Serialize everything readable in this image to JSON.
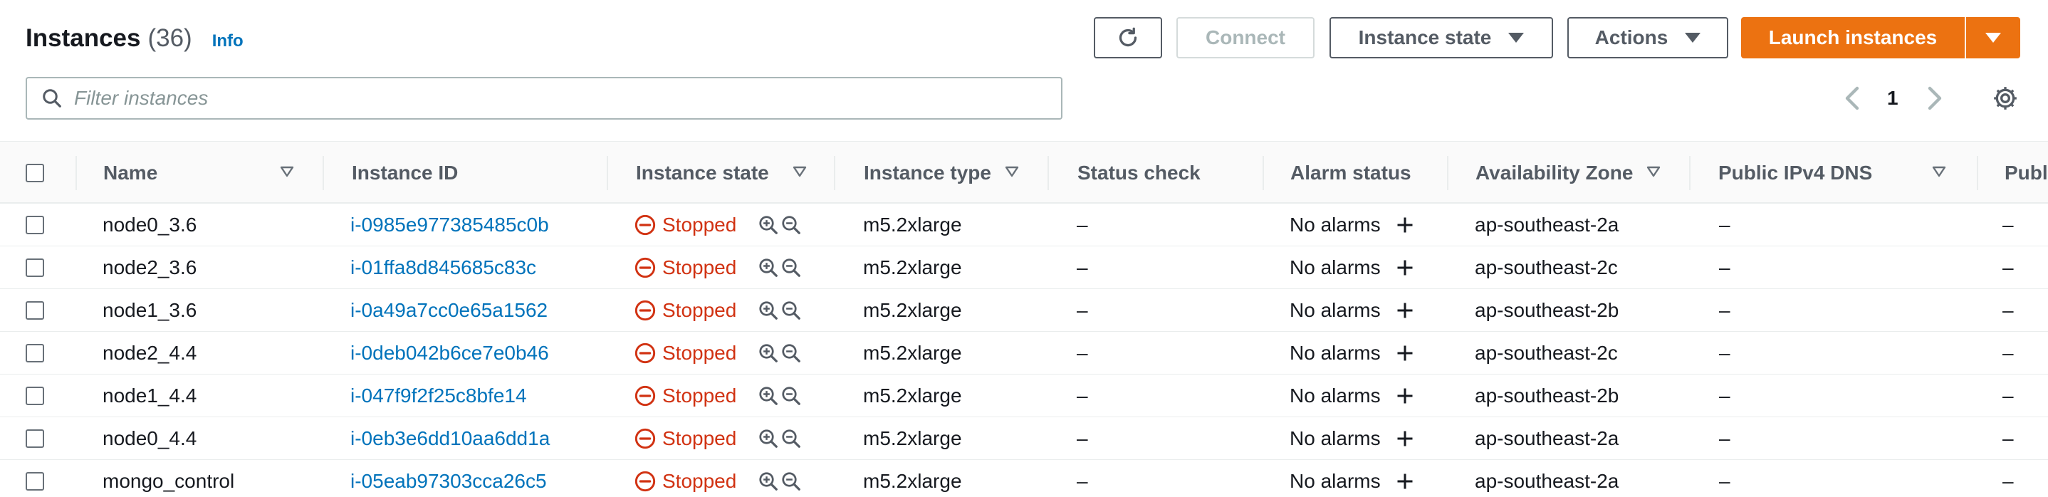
{
  "header": {
    "title": "Instances",
    "count": "(36)",
    "info": "Info"
  },
  "toolbar": {
    "refresh_icon": "refresh-icon",
    "connect": "Connect",
    "instance_state": "Instance state",
    "actions": "Actions",
    "launch": "Launch instances"
  },
  "filter": {
    "placeholder": "Filter instances",
    "value": ""
  },
  "pagination": {
    "page": "1"
  },
  "columns": {
    "name": "Name",
    "instance_id": "Instance ID",
    "instance_state": "Instance state",
    "instance_type": "Instance type",
    "status_check": "Status check",
    "alarm_status": "Alarm status",
    "availability_zone": "Availability Zone",
    "public_ipv4_dns": "Public IPv4 DNS",
    "public_ipv4_ip": "Publ"
  },
  "rows": [
    {
      "name": "node0_3.6",
      "id": "i-0985e977385485c0b",
      "state": "Stopped",
      "type": "m5.2xlarge",
      "status": "–",
      "alarm": "No alarms",
      "az": "ap-southeast-2a",
      "dns": "–",
      "ip": "–"
    },
    {
      "name": "node2_3.6",
      "id": "i-01ffa8d845685c83c",
      "state": "Stopped",
      "type": "m5.2xlarge",
      "status": "–",
      "alarm": "No alarms",
      "az": "ap-southeast-2c",
      "dns": "–",
      "ip": "–"
    },
    {
      "name": "node1_3.6",
      "id": "i-0a49a7cc0e65a1562",
      "state": "Stopped",
      "type": "m5.2xlarge",
      "status": "–",
      "alarm": "No alarms",
      "az": "ap-southeast-2b",
      "dns": "–",
      "ip": "–"
    },
    {
      "name": "node2_4.4",
      "id": "i-0deb042b6ce7e0b46",
      "state": "Stopped",
      "type": "m5.2xlarge",
      "status": "–",
      "alarm": "No alarms",
      "az": "ap-southeast-2c",
      "dns": "–",
      "ip": "–"
    },
    {
      "name": "node1_4.4",
      "id": "i-047f9f2f25c8bfe14",
      "state": "Stopped",
      "type": "m5.2xlarge",
      "status": "–",
      "alarm": "No alarms",
      "az": "ap-southeast-2b",
      "dns": "–",
      "ip": "–"
    },
    {
      "name": "node0_4.4",
      "id": "i-0eb3e6dd10aa6dd1a",
      "state": "Stopped",
      "type": "m5.2xlarge",
      "status": "–",
      "alarm": "No alarms",
      "az": "ap-southeast-2a",
      "dns": "–",
      "ip": "–"
    },
    {
      "name": "mongo_control",
      "id": "i-05eab97303cca26c5",
      "state": "Stopped",
      "type": "m5.2xlarge",
      "status": "–",
      "alarm": "No alarms",
      "az": "ap-southeast-2a",
      "dns": "–",
      "ip": "–"
    }
  ],
  "colors": {
    "link": "#0073bb",
    "stopped": "#d13212",
    "primary": "#ec7211",
    "text": "#16191f",
    "muted": "#545b64"
  }
}
